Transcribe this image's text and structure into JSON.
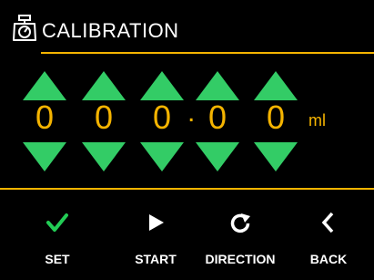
{
  "colors": {
    "accent": "#f5b400",
    "arrow": "#33cc66",
    "check": "#22cc55",
    "text": "#ffffff",
    "background": "#000000"
  },
  "header": {
    "icon": "scale-icon",
    "title": "CALIBRATION"
  },
  "entry": {
    "digits": [
      "0",
      "0",
      "0",
      "0",
      "0"
    ],
    "decimal_point": ".",
    "unit": "ml",
    "up_icon": "triangle-up-icon",
    "down_icon": "triangle-down-icon"
  },
  "footer": {
    "buttons": [
      {
        "label": "SET",
        "icon": "check-icon"
      },
      {
        "label": "START",
        "icon": "play-icon"
      },
      {
        "label": "DIRECTION",
        "icon": "rotate-icon"
      },
      {
        "label": "BACK",
        "icon": "chevron-left-icon"
      }
    ]
  }
}
